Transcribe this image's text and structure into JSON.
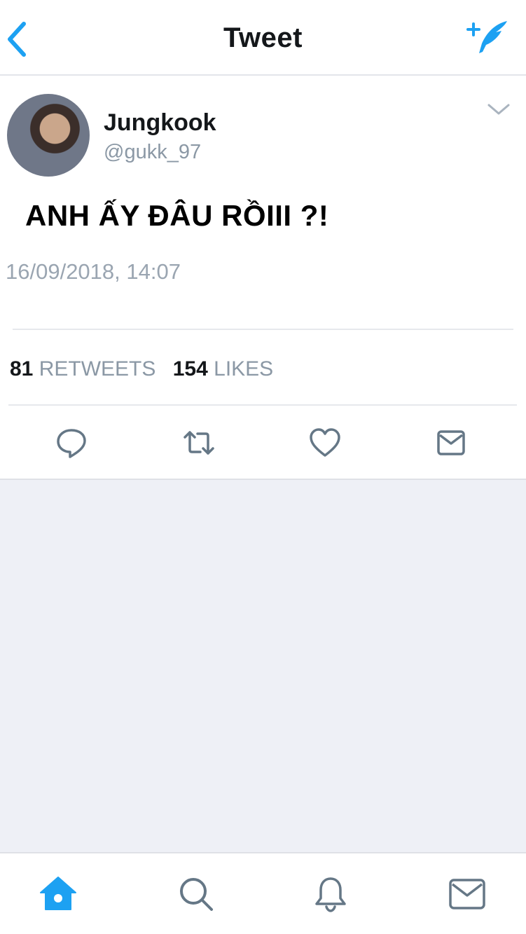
{
  "colors": {
    "accent": "#1da1f2",
    "icon_gray": "#657786",
    "text_primary": "#14171a",
    "text_secondary": "#8b98a5",
    "background": "#eef0f6"
  },
  "header": {
    "title": "Tweet",
    "back_icon": "chevron-left-icon",
    "compose_icon": "compose-quill-icon"
  },
  "tweet": {
    "display_name": "Jungkook",
    "handle": "@gukk_97",
    "text": "ANH ẤY ĐÂU RỒIII ?!",
    "timestamp": "16/09/2018, 14:07",
    "stats": {
      "retweets_count": "81",
      "retweets_label": "RETWEETS",
      "likes_count": "154",
      "likes_label": "LIKES"
    },
    "actions": [
      "reply-icon",
      "retweet-icon",
      "like-icon",
      "direct-message-icon"
    ]
  },
  "tabbar": {
    "tabs": [
      "home-icon",
      "search-icon",
      "notifications-icon",
      "messages-icon"
    ],
    "active": "home-icon"
  }
}
